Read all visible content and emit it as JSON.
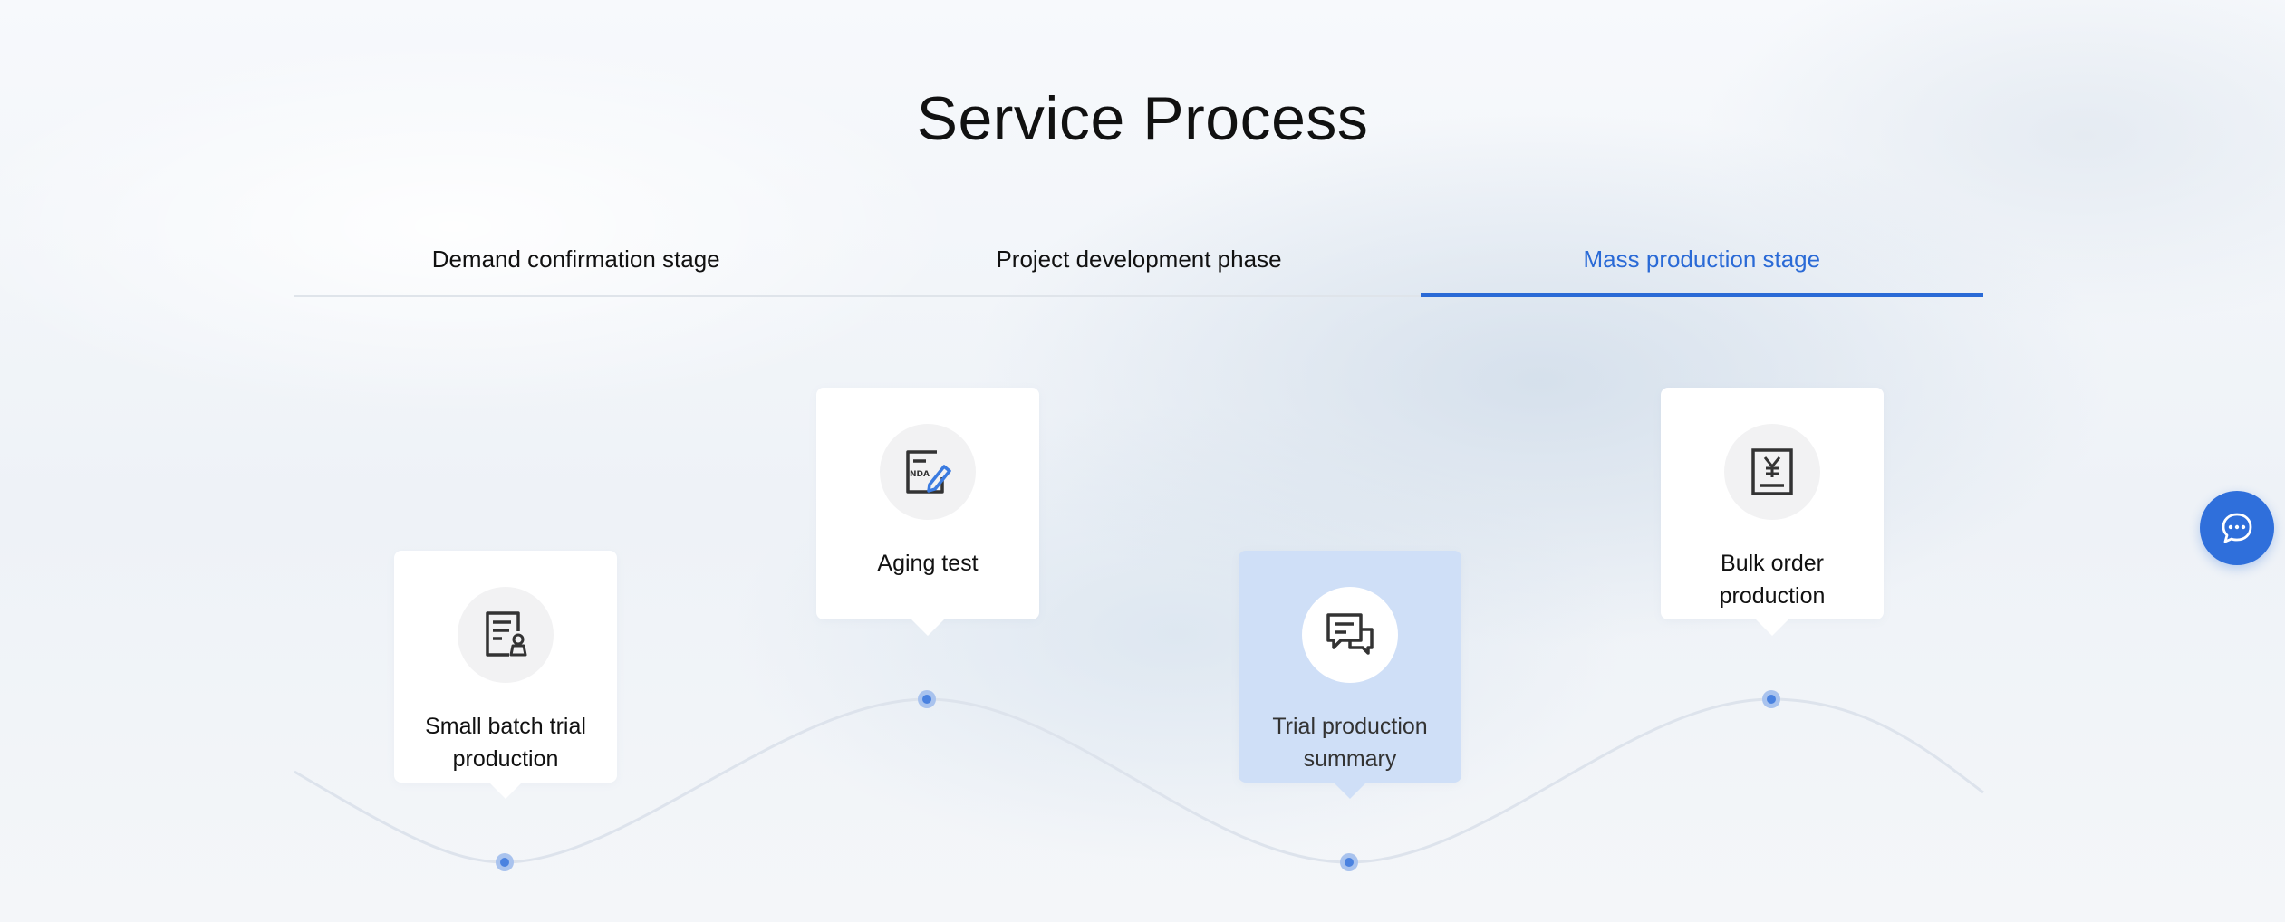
{
  "section": {
    "title": "Service Process"
  },
  "tabs": [
    {
      "label": "Demand confirmation stage",
      "active": false
    },
    {
      "label": "Project development phase",
      "active": false
    },
    {
      "label": "Mass production stage",
      "active": true
    }
  ],
  "steps": [
    {
      "label": "Small batch trial production",
      "icon": "document-stamp-icon",
      "highlighted": false
    },
    {
      "label": "Aging test",
      "icon": "nda-edit-icon",
      "highlighted": false
    },
    {
      "label": "Trial production summary",
      "icon": "chat-messages-icon",
      "highlighted": true
    },
    {
      "label": "Bulk order production",
      "icon": "yen-invoice-icon",
      "highlighted": false
    }
  ],
  "icons": {
    "nda_text": "NDA"
  },
  "colors": {
    "accent": "#2a6ad6",
    "highlight_card": "#cfdff7",
    "chat_button": "#2f6fdb"
  },
  "chat_button": {
    "icon": "chat-bubble-icon"
  }
}
